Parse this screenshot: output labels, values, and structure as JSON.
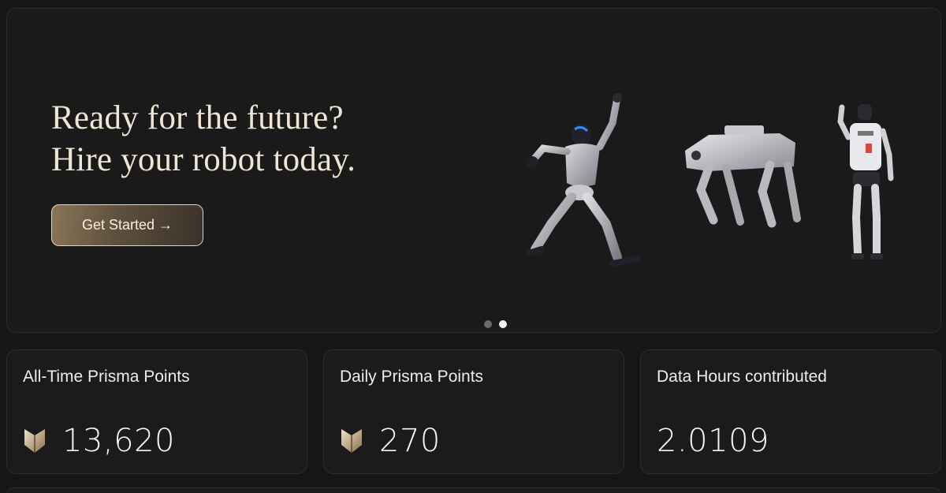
{
  "hero": {
    "title_line1": "Ready for the future?",
    "title_line2": "Hire your robot today.",
    "cta_label": "Get Started →",
    "carousel": {
      "slide_count": 2,
      "active_index": 1
    }
  },
  "stats": [
    {
      "label": "All-Time Prisma Points",
      "value": "13,620",
      "icon": "prisma-points-icon"
    },
    {
      "label": "Daily Prisma Points",
      "value": "270",
      "icon": "prisma-points-icon"
    },
    {
      "label": "Data Hours contributed",
      "value": "2.0109",
      "icon": null
    }
  ],
  "colors": {
    "background": "#161616",
    "card": "#1c1b1b",
    "title": "#efe5d4",
    "cta_border": "#e7d3b5",
    "accent_gold": "#b69a72"
  }
}
